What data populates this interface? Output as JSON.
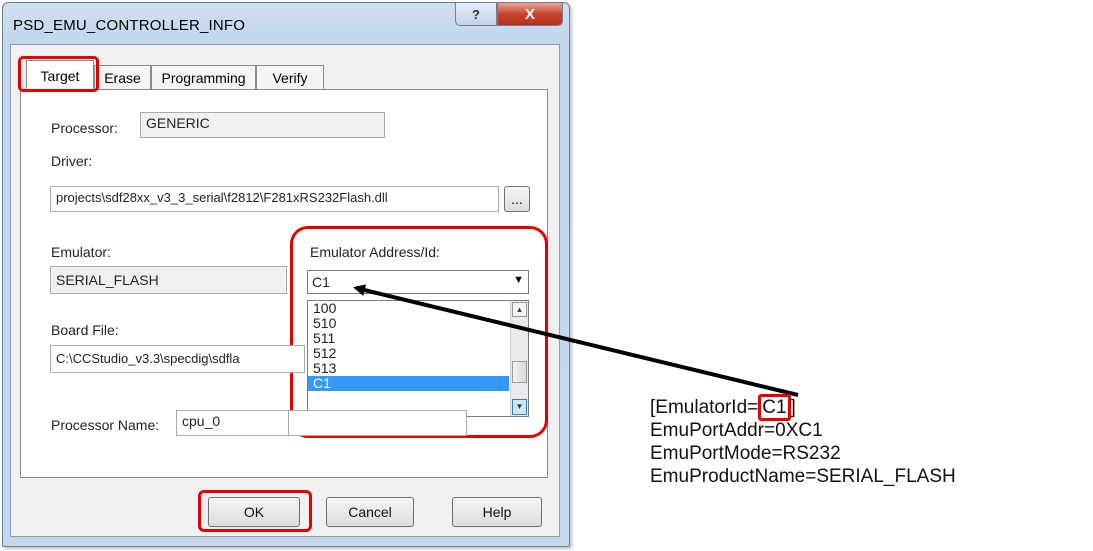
{
  "dialog": {
    "title": "PSD_EMU_CONTROLLER_INFO",
    "help_button": "?",
    "close_button": "X"
  },
  "tabs": [
    "Target",
    "Erase",
    "Programming",
    "Verify"
  ],
  "target": {
    "processor_label": "Processor:",
    "processor_value": "GENERIC",
    "driver_label": "Driver:",
    "driver_value": "projects\\sdf28xx_v3_3_serial\\f2812\\F281xRS232Flash.dll",
    "browse_label": "...",
    "emulator_label": "Emulator:",
    "emulator_value": "SERIAL_FLASH",
    "emulator_address_label": "Emulator Address/Id:",
    "emulator_address_value": "C1",
    "emulator_address_options": [
      "100",
      "510",
      "511",
      "512",
      "513",
      "C1"
    ],
    "board_file_label": "Board File:",
    "board_file_value": "C:\\CCStudio_v3.3\\specdig\\sdfla",
    "processor_name_label": "Processor Name:",
    "processor_name_value": "cpu_0"
  },
  "buttons": {
    "ok": "OK",
    "cancel": "Cancel",
    "help": "Help"
  },
  "annotation": {
    "line1_prefix": "[EmulatorId=",
    "line1_value": "C1",
    "line1_suffix": "]",
    "line2": "EmuPortAddr=0XC1",
    "line3": "EmuPortMode=RS232",
    "line4": "EmuProductName=SERIAL_FLASH"
  },
  "colors": {
    "highlight": "#e50000",
    "selection": "#3399ff"
  }
}
